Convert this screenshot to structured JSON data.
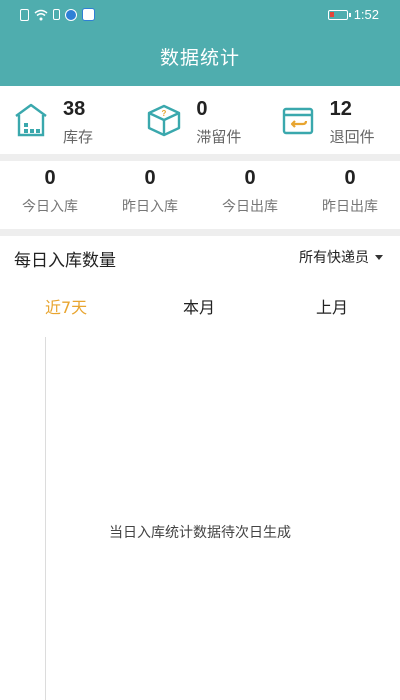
{
  "status_bar": {
    "time": "1:52",
    "icons": [
      "sim-icon",
      "wifi-icon",
      "sd-icon",
      "app-notification-icon",
      "app-notification-icon-2",
      "battery-low-icon"
    ]
  },
  "header": {
    "title": "数据统计"
  },
  "summary": [
    {
      "value": "38",
      "label": "库存",
      "icon": "warehouse-icon"
    },
    {
      "value": "0",
      "label": "滞留件",
      "icon": "stranded-parcel-icon"
    },
    {
      "value": "12",
      "label": "退回件",
      "icon": "return-parcel-icon"
    }
  ],
  "counts": [
    {
      "value": "0",
      "label": "今日入库"
    },
    {
      "value": "0",
      "label": "昨日入库"
    },
    {
      "value": "0",
      "label": "今日出库"
    },
    {
      "value": "0",
      "label": "昨日出库"
    }
  ],
  "section": {
    "title": "每日入库数量",
    "courier_filter": "所有快递员"
  },
  "tabs": [
    {
      "label": "近7天",
      "active": true
    },
    {
      "label": "本月",
      "active": false
    },
    {
      "label": "上月",
      "active": false
    }
  ],
  "chart": {
    "empty_message": "当日入库统计数据待次日生成"
  },
  "colors": {
    "brand": "#4fadae",
    "active_tab": "#e8a530",
    "icon_teal": "#3aa8ad",
    "divider": "#eeeeee"
  }
}
